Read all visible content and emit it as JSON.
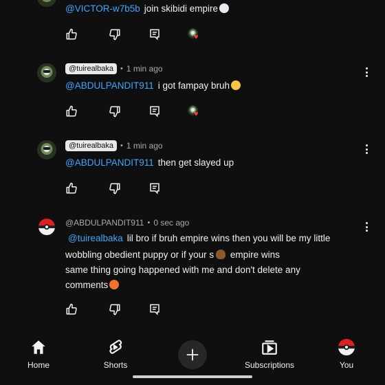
{
  "comments": [
    {
      "mention": "@VICTOR-w7b5b",
      "text": "join skibidi empire",
      "emoji": "ghost-emoji",
      "creator_heart": true
    },
    {
      "author": "@tuirealbaka",
      "time": "1 min ago",
      "mention": "@ABDULPANDIT911",
      "text": "i got fampay bruh",
      "emoji": "crying-emoji",
      "creator_heart": true
    },
    {
      "author": "@tuirealbaka",
      "time": "1 min ago",
      "mention": "@ABDULPANDIT911",
      "text": "then get slayed up",
      "creator_heart": false
    },
    {
      "author": "@ABDULPANDIT911",
      "time": "0 sec ago",
      "mention": "@tuirealbaka",
      "line1": "lil bro if bruh empire wins then you will be my little",
      "line2_a": "wobbling obedient puppy or if your s",
      "line2_b": " empire wins",
      "line3": "same thing going happened with me and don't delete any",
      "line4": "comments",
      "creator_heart": false
    }
  ],
  "separator": "•",
  "nav": {
    "home": "Home",
    "shorts": "Shorts",
    "subscriptions": "Subscriptions",
    "you": "You"
  },
  "colors": {
    "background": "#0f0f0f",
    "mention": "#3ea6ff",
    "heart": "#ff3b3b"
  }
}
